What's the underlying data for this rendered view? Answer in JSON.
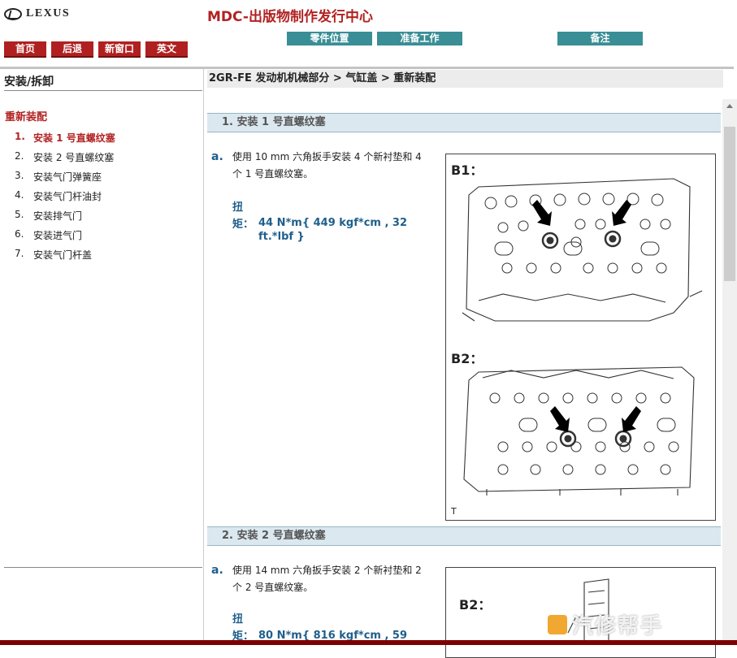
{
  "header": {
    "brand": "LEXUS",
    "site_title": "MDC-出版物制作发行中心",
    "nav_buttons": [
      "首页",
      "后退",
      "新窗口",
      "英文"
    ],
    "tabs": [
      "零件位置",
      "准备工作",
      "备注"
    ]
  },
  "sidebar": {
    "title": "安装/拆卸",
    "section": "重新装配",
    "items": [
      {
        "num": "1.",
        "label": "安装 1 号直螺纹塞"
      },
      {
        "num": "2.",
        "label": "安装 2 号直螺纹塞"
      },
      {
        "num": "3.",
        "label": "安装气门弹簧座"
      },
      {
        "num": "4.",
        "label": "安装气门杆油封"
      },
      {
        "num": "5.",
        "label": "安装排气门"
      },
      {
        "num": "6.",
        "label": "安装进气门"
      },
      {
        "num": "7.",
        "label": "安装气门杆盖"
      }
    ]
  },
  "breadcrumb": "2GR-FE 发动机机械部分 > 气缸盖 > 重新装配",
  "steps": [
    {
      "heading": "1. 安装 1 号直螺纹塞",
      "letter": "a.",
      "text": "使用 10 mm 六角扳手安装 4 个新衬垫和 4 个 1 号直螺纹塞。",
      "torque_label": "扭矩：",
      "torque_value": "44 N*m{ 449 kgf*cm , 32 ft.*lbf }",
      "figure_labels": [
        "B1：",
        "B2：",
        "T"
      ]
    },
    {
      "heading": "2. 安装 2 号直螺纹塞",
      "letter": "a.",
      "text": "使用 14 mm 六角扳手安装 2 个新衬垫和 2 个 2 号直螺纹塞。",
      "torque_label": "扭矩：",
      "torque_value": "80 N*m{ 816 kgf*cm , 59",
      "figure_labels": [
        "B2："
      ]
    }
  ],
  "watermark": "汽修帮手",
  "colors": {
    "accent_red": "#b22222",
    "tab_teal": "#3a8e96",
    "section_blue": "#1f5f8b"
  }
}
